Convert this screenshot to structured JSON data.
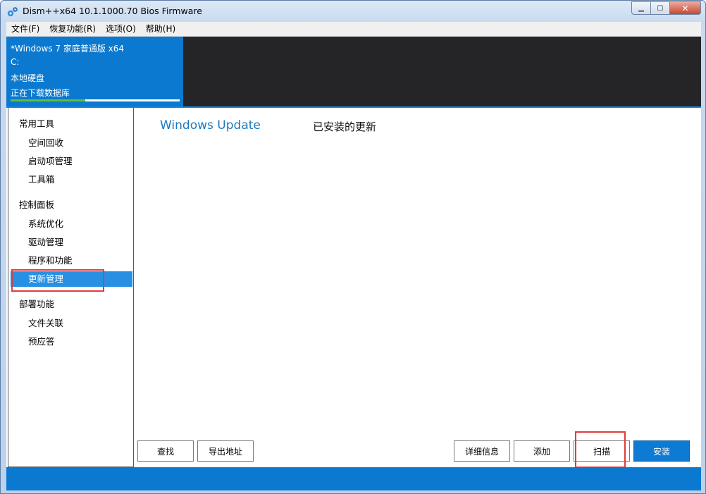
{
  "window": {
    "title": "Dism++x64 10.1.1000.70 Bios Firmware",
    "min_glyph": "▁",
    "max_glyph": "▢",
    "close_glyph": "✕"
  },
  "menu": [
    "文件(F)",
    "恢复功能(R)",
    "选项(O)",
    "帮助(H)"
  ],
  "session": {
    "os_name": "*Windows 7 家庭普通版 x64",
    "drive": "C:",
    "disk_type": "本地硬盘",
    "status": "正在下载数据库",
    "progress": 0.44
  },
  "sidebar": {
    "groups": [
      {
        "label": "常用工具",
        "items": [
          "空间回收",
          "启动项管理",
          "工具箱"
        ]
      },
      {
        "label": "控制面板",
        "items": [
          "系统优化",
          "驱动管理",
          "程序和功能",
          "更新管理"
        ]
      },
      {
        "label": "部署功能",
        "items": [
          "文件关联",
          "预应答"
        ]
      }
    ],
    "selected": "更新管理"
  },
  "main": {
    "title": "Windows Update",
    "subtitle": "已安装的更新"
  },
  "buttons": {
    "find": "查找",
    "export": "导出地址",
    "details": "详细信息",
    "add": "添加",
    "scan": "扫描",
    "install": "安装"
  },
  "colors": {
    "accent": "#0b79cf",
    "selected": "#2790e3",
    "highlight": "#e23b3b",
    "progress": "#5fbf3b"
  }
}
